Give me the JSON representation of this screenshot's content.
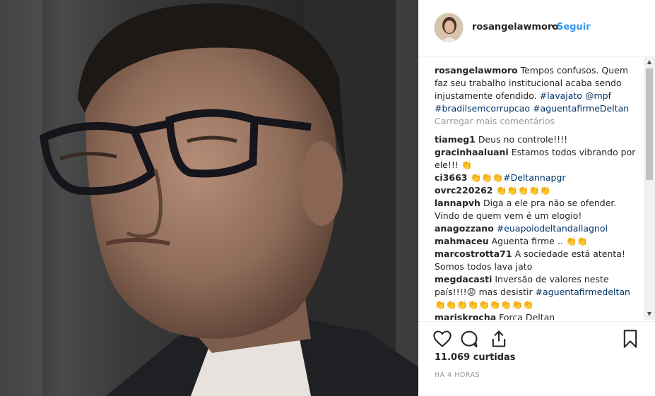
{
  "post": {
    "username": "rosangelawmoro",
    "separator": "•",
    "follow_label": "Seguir",
    "likes": "11.069 curtidas",
    "time": "HÁ 4 HORAS"
  },
  "caption": {
    "username": "rosangelawmoro",
    "text": "Tempos confusos. Quem faz seu trabalho institucional acaba sendo injustamente ofendido.",
    "tag1": "#lavajato",
    "tag2": "@mpf",
    "tag3": "#bradilsemcorrupcao",
    "tag4": "#aguentafirmeDeltan"
  },
  "load_more": "Carregar mais comentários",
  "comments": [
    {
      "user": "tiameg1",
      "text": "Deus no controle!!!!"
    },
    {
      "user": "gracinhaaluani",
      "text": "Estamos todos vibrando por ele!!! 👏"
    },
    {
      "user": "ci3663",
      "text": "👏👏👏",
      "tag": "#Deltannapgr"
    },
    {
      "user": "ovrc220262",
      "text": "👏👏👏👏👏"
    },
    {
      "user": "lannapvh",
      "text": "Diga a ele pra não se ofender. Vindo de quem vem é um elogio!"
    },
    {
      "user": "anagozzano",
      "tag": "#euapoiodeltandallagnol"
    },
    {
      "user": "mahmaceu",
      "text": "Aguenta firme .. 👏👏"
    },
    {
      "user": "marcostrotta71",
      "text": "A sociedade está atenta! Somos todos lava jato"
    },
    {
      "user": "megdacasti",
      "text": "Inversão de valores neste país!!!!😡 mas desistir",
      "tag": "#aguentafirmedeltan",
      "extra": "👏👏👏👏👏👏👏👏👏"
    },
    {
      "user": "mariskrocha",
      "text": "Força Deltan"
    }
  ],
  "icons": {
    "like": "heart-icon",
    "comment": "comment-icon",
    "share": "share-icon",
    "save": "bookmark-icon"
  },
  "colors": {
    "link": "#3897f0",
    "hashtag": "#003569",
    "muted": "#999999"
  }
}
